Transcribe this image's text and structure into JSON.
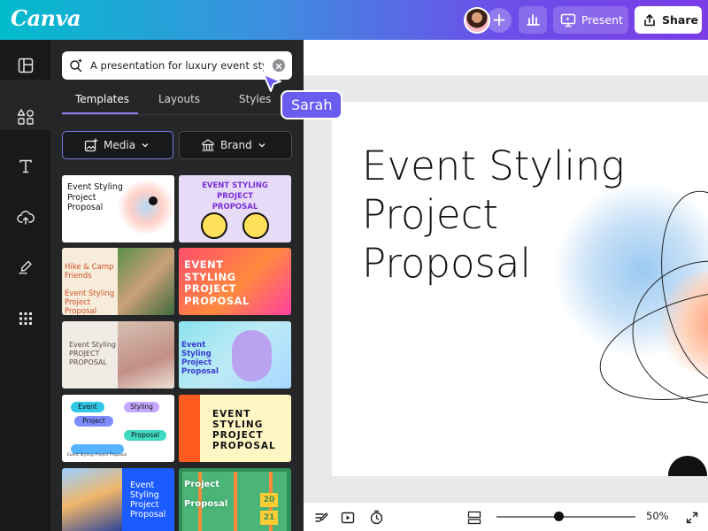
{
  "app": {
    "logo": "Canva"
  },
  "header": {
    "present_label": "Present",
    "share_label": "Share",
    "add_collaborator_glyph": "+"
  },
  "rail": {
    "items": [
      "layout-icon",
      "elements-icon",
      "text-icon",
      "upload-icon",
      "draw-icon",
      "apps-icon"
    ]
  },
  "panel": {
    "search": {
      "value": "A presentation for luxury event sty..."
    },
    "tabs": [
      "Templates",
      "Layouts",
      "Styles"
    ],
    "filters": {
      "media_label": "Media",
      "brand_label": "Brand"
    },
    "templates": [
      {
        "text": "Event Styling\nProject\nProposal"
      },
      {
        "text": "EVENT STYLING PROJECT\nPROPOSAL"
      },
      {
        "text": "Hike & Camp\nFriends\n\nEvent Styling Project\nProposal"
      },
      {
        "text": "EVENT\nSTYLING\nPROJECT\nPROPOSAL"
      },
      {
        "text": "Event Styling\nPROJECT\nPROPOSAL"
      },
      {
        "text": "Event\nStyling\nProject\nProposal"
      },
      {
        "text": "Event Styling Project Proposal"
      },
      {
        "text": "EVENT\nSTYLING\nPROJECT\nPROPOSAL"
      },
      {
        "text": "Event\nStyling\nProject\nProposal"
      },
      {
        "text": "Project\nProposal"
      }
    ],
    "tpl7_chips": [
      "Event",
      "Styling",
      "Project",
      "Proposal"
    ],
    "tpl10_numbers": [
      "20",
      "21"
    ]
  },
  "collaborator": {
    "name": "Sarah"
  },
  "slide": {
    "title": "Event Styling\nProject\nProposal"
  },
  "bottom": {
    "zoom": "50%",
    "zoom_level": 0.45
  },
  "colors": {
    "accent": "#6b5cf0",
    "panel_bg": "#252627",
    "rail_bg": "#18191b"
  }
}
